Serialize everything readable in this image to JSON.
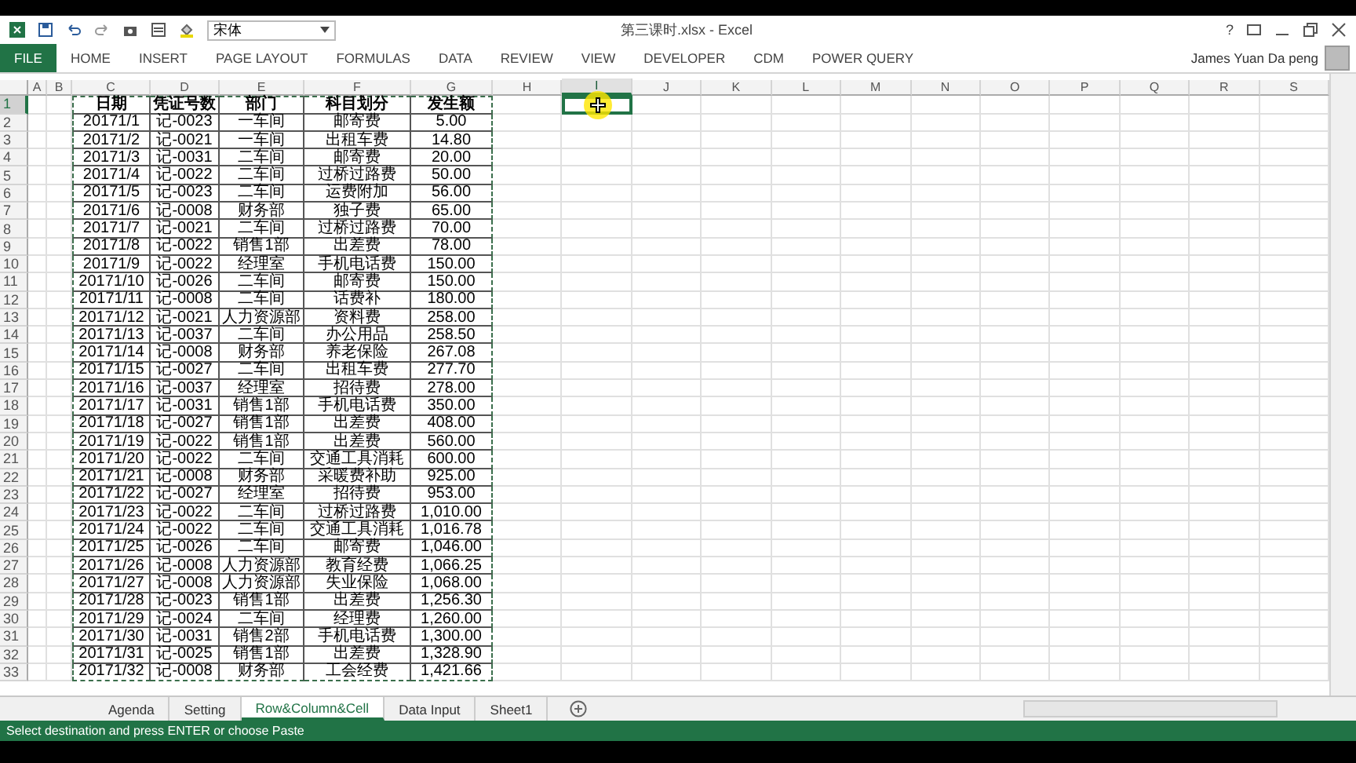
{
  "title_bar": {
    "font_box": "宋体",
    "title": "第三课时.xlsx - Excel",
    "help": "?"
  },
  "ribbon": {
    "tabs": [
      {
        "label": "FILE",
        "kind": "file"
      },
      {
        "label": "HOME",
        "kind": "tab"
      },
      {
        "label": "INSERT",
        "kind": "tab"
      },
      {
        "label": "PAGE LAYOUT",
        "kind": "tab"
      },
      {
        "label": "FORMULAS",
        "kind": "tab"
      },
      {
        "label": "DATA",
        "kind": "tab"
      },
      {
        "label": "REVIEW",
        "kind": "tab"
      },
      {
        "label": "VIEW",
        "kind": "tab"
      },
      {
        "label": "DEVELOPER",
        "kind": "tab"
      },
      {
        "label": "CDM",
        "kind": "tab"
      },
      {
        "label": "POWER QUERY",
        "kind": "tab"
      }
    ],
    "user": "James Yuan Da peng"
  },
  "columns": [
    {
      "label": "A",
      "selected": false
    },
    {
      "label": "B",
      "selected": false
    },
    {
      "label": "C",
      "selected": false
    },
    {
      "label": "D",
      "selected": false
    },
    {
      "label": "E",
      "selected": false
    },
    {
      "label": "F",
      "selected": false
    },
    {
      "label": "G",
      "selected": false
    },
    {
      "label": "H",
      "selected": false
    },
    {
      "label": "I",
      "selected": true
    },
    {
      "label": "J",
      "selected": false
    },
    {
      "label": "K",
      "selected": false
    },
    {
      "label": "L",
      "selected": false
    },
    {
      "label": "M",
      "selected": false
    },
    {
      "label": "N",
      "selected": false
    },
    {
      "label": "O",
      "selected": false
    },
    {
      "label": "P",
      "selected": false
    },
    {
      "label": "Q",
      "selected": false
    },
    {
      "label": "R",
      "selected": false
    },
    {
      "label": "S",
      "selected": false
    }
  ],
  "rows": [
    {
      "n": "1",
      "selected": true,
      "header": true,
      "cells": [
        "日期",
        "凭证号数",
        "部门",
        "科目划分",
        "发生额"
      ]
    },
    {
      "n": "2",
      "selected": false,
      "header": false,
      "cells": [
        "20171/1",
        "记-0023",
        "一车间",
        "邮寄费",
        "5.00"
      ]
    },
    {
      "n": "3",
      "selected": false,
      "header": false,
      "cells": [
        "20171/2",
        "记-0021",
        "一车间",
        "出租车费",
        "14.80"
      ]
    },
    {
      "n": "4",
      "selected": false,
      "header": false,
      "cells": [
        "20171/3",
        "记-0031",
        "二车间",
        "邮寄费",
        "20.00"
      ]
    },
    {
      "n": "5",
      "selected": false,
      "header": false,
      "cells": [
        "20171/4",
        "记-0022",
        "二车间",
        "过桥过路费",
        "50.00"
      ]
    },
    {
      "n": "6",
      "selected": false,
      "header": false,
      "cells": [
        "20171/5",
        "记-0023",
        "二车间",
        "运费附加",
        "56.00"
      ]
    },
    {
      "n": "7",
      "selected": false,
      "header": false,
      "cells": [
        "20171/6",
        "记-0008",
        "财务部",
        "独子费",
        "65.00"
      ]
    },
    {
      "n": "8",
      "selected": false,
      "header": false,
      "cells": [
        "20171/7",
        "记-0021",
        "二车间",
        "过桥过路费",
        "70.00"
      ]
    },
    {
      "n": "9",
      "selected": false,
      "header": false,
      "cells": [
        "20171/8",
        "记-0022",
        "销售1部",
        "出差费",
        "78.00"
      ]
    },
    {
      "n": "10",
      "selected": false,
      "header": false,
      "cells": [
        "20171/9",
        "记-0022",
        "经理室",
        "手机电话费",
        "150.00"
      ]
    },
    {
      "n": "11",
      "selected": false,
      "header": false,
      "cells": [
        "20171/10",
        "记-0026",
        "二车间",
        "邮寄费",
        "150.00"
      ]
    },
    {
      "n": "12",
      "selected": false,
      "header": false,
      "cells": [
        "20171/11",
        "记-0008",
        "二车间",
        "话费补",
        "180.00"
      ]
    },
    {
      "n": "13",
      "selected": false,
      "header": false,
      "cells": [
        "20171/12",
        "记-0021",
        "人力资源部",
        "资料费",
        "258.00"
      ]
    },
    {
      "n": "14",
      "selected": false,
      "header": false,
      "cells": [
        "20171/13",
        "记-0037",
        "二车间",
        "办公用品",
        "258.50"
      ]
    },
    {
      "n": "15",
      "selected": false,
      "header": false,
      "cells": [
        "20171/14",
        "记-0008",
        "财务部",
        "养老保险",
        "267.08"
      ]
    },
    {
      "n": "16",
      "selected": false,
      "header": false,
      "cells": [
        "20171/15",
        "记-0027",
        "二车间",
        "出租车费",
        "277.70"
      ]
    },
    {
      "n": "17",
      "selected": false,
      "header": false,
      "cells": [
        "20171/16",
        "记-0037",
        "经理室",
        "招待费",
        "278.00"
      ]
    },
    {
      "n": "18",
      "selected": false,
      "header": false,
      "cells": [
        "20171/17",
        "记-0031",
        "销售1部",
        "手机电话费",
        "350.00"
      ]
    },
    {
      "n": "19",
      "selected": false,
      "header": false,
      "cells": [
        "20171/18",
        "记-0027",
        "销售1部",
        "出差费",
        "408.00"
      ]
    },
    {
      "n": "20",
      "selected": false,
      "header": false,
      "cells": [
        "20171/19",
        "记-0022",
        "销售1部",
        "出差费",
        "560.00"
      ]
    },
    {
      "n": "21",
      "selected": false,
      "header": false,
      "cells": [
        "20171/20",
        "记-0022",
        "二车间",
        "交通工具消耗",
        "600.00"
      ]
    },
    {
      "n": "22",
      "selected": false,
      "header": false,
      "cells": [
        "20171/21",
        "记-0008",
        "财务部",
        "采暖费补助",
        "925.00"
      ]
    },
    {
      "n": "23",
      "selected": false,
      "header": false,
      "cells": [
        "20171/22",
        "记-0027",
        "经理室",
        "招待费",
        "953.00"
      ]
    },
    {
      "n": "24",
      "selected": false,
      "header": false,
      "cells": [
        "20171/23",
        "记-0022",
        "二车间",
        "过桥过路费",
        "1,010.00"
      ]
    },
    {
      "n": "25",
      "selected": false,
      "header": false,
      "cells": [
        "20171/24",
        "记-0022",
        "二车间",
        "交通工具消耗",
        "1,016.78"
      ]
    },
    {
      "n": "26",
      "selected": false,
      "header": false,
      "cells": [
        "20171/25",
        "记-0026",
        "二车间",
        "邮寄费",
        "1,046.00"
      ]
    },
    {
      "n": "27",
      "selected": false,
      "header": false,
      "cells": [
        "20171/26",
        "记-0008",
        "人力资源部",
        "教育经费",
        "1,066.25"
      ]
    },
    {
      "n": "28",
      "selected": false,
      "header": false,
      "cells": [
        "20171/27",
        "记-0008",
        "人力资源部",
        "失业保险",
        "1,068.00"
      ]
    },
    {
      "n": "29",
      "selected": false,
      "header": false,
      "cells": [
        "20171/28",
        "记-0023",
        "销售1部",
        "出差费",
        "1,256.30"
      ]
    },
    {
      "n": "30",
      "selected": false,
      "header": false,
      "cells": [
        "20171/29",
        "记-0024",
        "二车间",
        "经理费",
        "1,260.00"
      ]
    },
    {
      "n": "31",
      "selected": false,
      "header": false,
      "cells": [
        "20171/30",
        "记-0031",
        "销售2部",
        "手机电话费",
        "1,300.00"
      ]
    },
    {
      "n": "32",
      "selected": false,
      "header": false,
      "cells": [
        "20171/31",
        "记-0025",
        "销售1部",
        "出差费",
        "1,328.90"
      ]
    },
    {
      "n": "33",
      "selected": false,
      "header": false,
      "cells": [
        "20171/32",
        "记-0008",
        "财务部",
        "工会经费",
        "1,421.66"
      ]
    }
  ],
  "sheet_tabs": [
    {
      "label": "Agenda",
      "selected": false
    },
    {
      "label": "Setting",
      "selected": false
    },
    {
      "label": "Row&Column&Cell",
      "selected": true
    },
    {
      "label": "Data Input",
      "selected": false
    },
    {
      "label": "Sheet1",
      "selected": false
    }
  ],
  "status_bar": "Select destination and press ENTER or choose Paste"
}
